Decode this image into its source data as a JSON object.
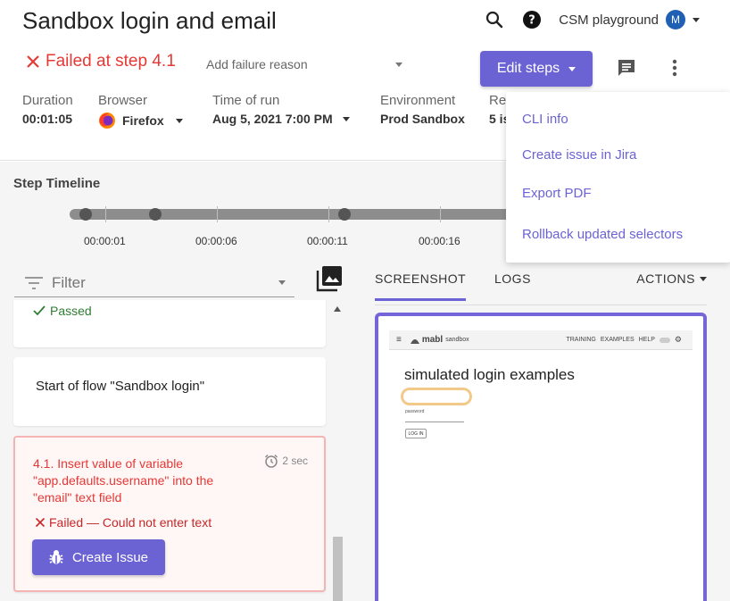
{
  "header": {
    "title": "Sandbox login and email",
    "workspace_name": "CSM playground",
    "avatar_letter": "M",
    "status_text": "Failed at step 4.1",
    "failure_reason_placeholder": "Add failure reason",
    "edit_steps_label": "Edit steps"
  },
  "meta": {
    "duration_label": "Duration",
    "duration_value": "00:01:05",
    "browser_label": "Browser",
    "browser_value": "Firefox",
    "time_label": "Time of run",
    "time_value": "Aug 5, 2021 7:00 PM",
    "environment_label": "Environment",
    "environment_value": "Prod Sandbox",
    "release_label": "Rel",
    "release_value": "5 is"
  },
  "timeline": {
    "title": "Step Timeline",
    "ticks": [
      "00:00:01",
      "00:00:06",
      "00:00:11",
      "00:00:16"
    ]
  },
  "filter": {
    "placeholder": "Filter"
  },
  "steps": {
    "passed_text": "Passed",
    "flow_text": "Start of flow \"Sandbox login\"",
    "failed_title": "4.1. Insert value of variable \"app.defaults.username\" into the \"email\" text field",
    "failed_duration": "2 sec",
    "failed_message": "Failed — Could not enter text",
    "create_issue_label": "Create Issue"
  },
  "tabs": {
    "screenshot": "SCREENSHOT",
    "logs": "LOGS",
    "actions": "ACTIONS"
  },
  "screenshot_preview": {
    "logo_text": "mabl",
    "logo_sub": "sandbox",
    "nav_links": [
      "TRAINING",
      "EXAMPLES",
      "HELP"
    ],
    "heading": "simulated login examples",
    "field_label": "password",
    "button_label": "LOG IN"
  },
  "dropdown_menu": {
    "items": [
      "CLI info",
      "Create issue in Jira",
      "Export PDF",
      "Rollback updated selectors"
    ]
  },
  "colors": {
    "accent": "#6b63d4",
    "error": "#e53935",
    "success": "#2e7d32"
  }
}
